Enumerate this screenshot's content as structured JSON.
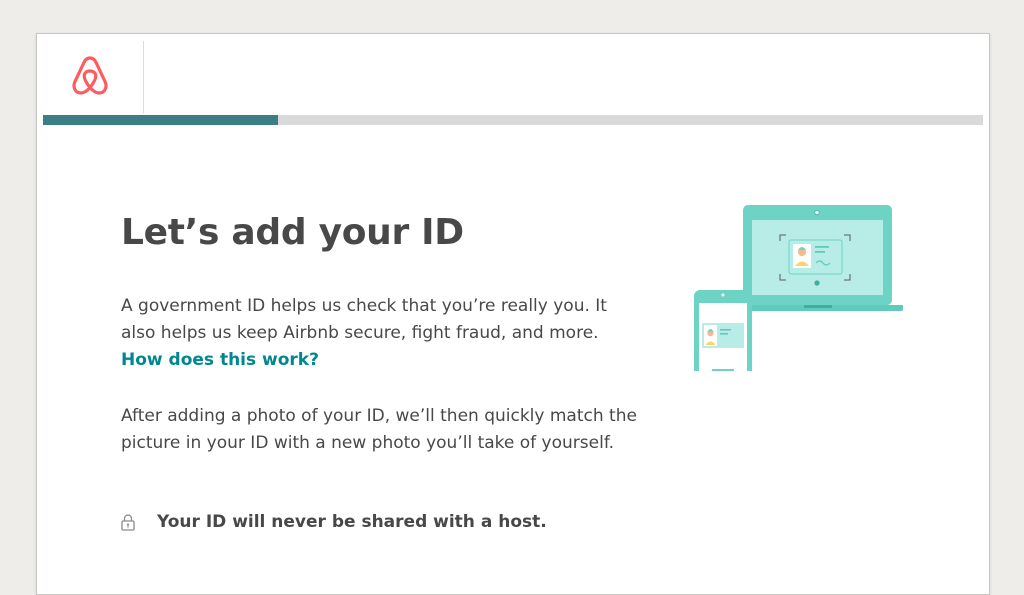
{
  "brand": {
    "name": "airbnb-logo",
    "color": "#ff5a5f"
  },
  "progress": {
    "fraction": 0.25,
    "color": "#3a7f86",
    "track_color": "#d9d9d9"
  },
  "page": {
    "title": "Let’s add your ID",
    "intro": "A government ID helps us check that you’re really you. It also helps us keep Airbnb secure, fight fraud, and more.",
    "help_link": "How does this work?",
    "detail": "After adding a photo of your ID, we’ll then quickly match the picture in your ID with a new photo you’ll take of yourself.",
    "privacy_notice": "Your ID will never be shared with a host.",
    "privacy_icon": "lock-icon"
  },
  "illustration": {
    "name": "id-verification-illustration",
    "accent": "#6dd3c4",
    "screen_color": "#b8ede7"
  }
}
